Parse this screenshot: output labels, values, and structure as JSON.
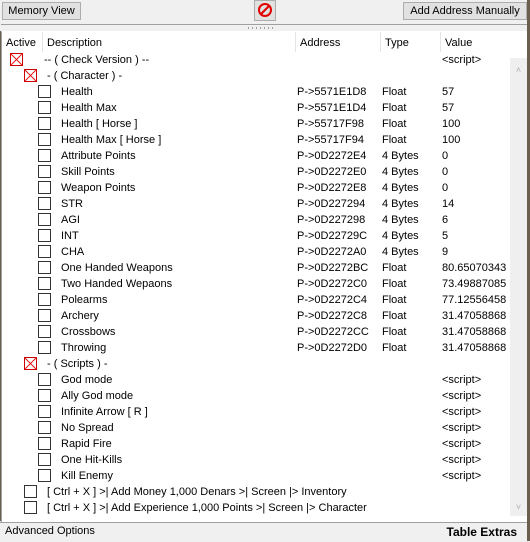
{
  "toolbar": {
    "memory_view_label": "Memory View",
    "add_address_label": "Add Address Manually",
    "clear_icon": "no-entry-icon"
  },
  "columns": {
    "active": "Active",
    "description": "Description",
    "address": "Address",
    "type": "Type",
    "value": "Value"
  },
  "rows": [
    {
      "indent": 0,
      "checked": true,
      "description": "-- ( Check Version ) --",
      "address": "",
      "type": "",
      "value": "<script>"
    },
    {
      "indent": 1,
      "checked": true,
      "description": "- ( Character ) -",
      "address": "",
      "type": "",
      "value": ""
    },
    {
      "indent": 2,
      "checked": false,
      "description": "Health",
      "address": "P->5571E1D8",
      "type": "Float",
      "value": "57"
    },
    {
      "indent": 2,
      "checked": false,
      "description": "Health Max",
      "address": "P->5571E1D4",
      "type": "Float",
      "value": "57"
    },
    {
      "indent": 2,
      "checked": false,
      "description": "Health [ Horse ]",
      "address": "P->55717F98",
      "type": "Float",
      "value": "100"
    },
    {
      "indent": 2,
      "checked": false,
      "description": "Health Max [ Horse ]",
      "address": "P->55717F94",
      "type": "Float",
      "value": "100"
    },
    {
      "indent": 2,
      "checked": false,
      "description": "Attribute Points",
      "address": "P->0D2272E4",
      "type": "4 Bytes",
      "value": "0"
    },
    {
      "indent": 2,
      "checked": false,
      "description": "Skill Points",
      "address": "P->0D2272E0",
      "type": "4 Bytes",
      "value": "0"
    },
    {
      "indent": 2,
      "checked": false,
      "description": "Weapon Points",
      "address": "P->0D2272E8",
      "type": "4 Bytes",
      "value": "0"
    },
    {
      "indent": 2,
      "checked": false,
      "description": "STR",
      "address": "P->0D227294",
      "type": "4 Bytes",
      "value": "14"
    },
    {
      "indent": 2,
      "checked": false,
      "description": "AGI",
      "address": "P->0D227298",
      "type": "4 Bytes",
      "value": "6"
    },
    {
      "indent": 2,
      "checked": false,
      "description": "INT",
      "address": "P->0D22729C",
      "type": "4 Bytes",
      "value": "5"
    },
    {
      "indent": 2,
      "checked": false,
      "description": "CHA",
      "address": "P->0D2272A0",
      "type": "4 Bytes",
      "value": "9"
    },
    {
      "indent": 2,
      "checked": false,
      "description": "One Handed Weapons",
      "address": "P->0D2272BC",
      "type": "Float",
      "value": "80.65070343"
    },
    {
      "indent": 2,
      "checked": false,
      "description": "Two Handed Wepaons",
      "address": "P->0D2272C0",
      "type": "Float",
      "value": "73.49887085"
    },
    {
      "indent": 2,
      "checked": false,
      "description": "Polearms",
      "address": "P->0D2272C4",
      "type": "Float",
      "value": "77.12556458"
    },
    {
      "indent": 2,
      "checked": false,
      "description": "Archery",
      "address": "P->0D2272C8",
      "type": "Float",
      "value": "31.47058868"
    },
    {
      "indent": 2,
      "checked": false,
      "description": "Crossbows",
      "address": "P->0D2272CC",
      "type": "Float",
      "value": "31.47058868"
    },
    {
      "indent": 2,
      "checked": false,
      "description": "Throwing",
      "address": "P->0D2272D0",
      "type": "Float",
      "value": "31.47058868"
    },
    {
      "indent": 1,
      "checked": true,
      "description": "- ( Scripts ) -",
      "address": "",
      "type": "",
      "value": ""
    },
    {
      "indent": 2,
      "checked": false,
      "description": "God mode",
      "address": "",
      "type": "",
      "value": "<script>"
    },
    {
      "indent": 2,
      "checked": false,
      "description": "Ally God mode",
      "address": "",
      "type": "",
      "value": "<script>"
    },
    {
      "indent": 2,
      "checked": false,
      "description": "Infinite Arrow [ R ]",
      "address": "",
      "type": "",
      "value": "<script>"
    },
    {
      "indent": 2,
      "checked": false,
      "description": "No Spread",
      "address": "",
      "type": "",
      "value": "<script>"
    },
    {
      "indent": 2,
      "checked": false,
      "description": "Rapid Fire",
      "address": "",
      "type": "",
      "value": "<script>"
    },
    {
      "indent": 2,
      "checked": false,
      "description": "One Hit-Kills",
      "address": "",
      "type": "",
      "value": "<script>"
    },
    {
      "indent": 2,
      "checked": false,
      "description": "Kill Enemy",
      "address": "",
      "type": "",
      "value": "<script>"
    },
    {
      "indent": 1,
      "checked": false,
      "description": "[ Ctrl + X ] >| Add Money 1,000 Denars >| Screen |> Inventory",
      "address": "",
      "type": "",
      "value": ""
    },
    {
      "indent": 1,
      "checked": false,
      "description": "[ Ctrl + X ] >| Add Experience 1,000 Points >| Screen |> Character",
      "address": "",
      "type": "",
      "value": ""
    }
  ],
  "footer": {
    "advanced_options": "Advanced Options",
    "table_extras": "Table Extras"
  }
}
